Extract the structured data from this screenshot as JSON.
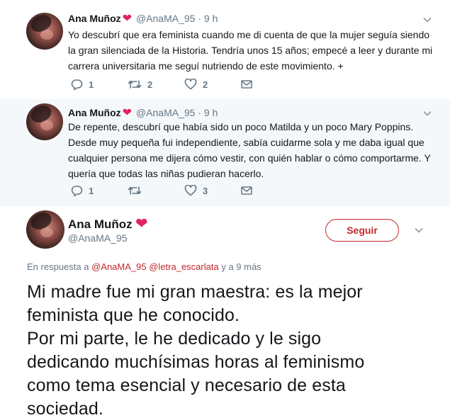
{
  "colors": {
    "heart": "#e0245e",
    "accent": "#c2272d",
    "muted": "#657786",
    "thread_line": "#d8a6b0"
  },
  "tweets": [
    {
      "name": "Ana Muñoz",
      "handle": "@AnaMA_95",
      "separator": "·",
      "time": "9 h",
      "text": "Yo descubrí que era feminista cuando me di cuenta de que la mujer seguía siendo la gran silenciada de la Historia. Tendría unos 15 años; empecé a leer y durante mi carrera universitaria me seguí nutriendo de este movimiento. +",
      "replies": "1",
      "retweets": "2",
      "likes": "2"
    },
    {
      "name": "Ana Muñoz",
      "handle": "@AnaMA_95",
      "separator": "·",
      "time": "9 h",
      "text": "De repente, descubrí que había sido un poco Matilda y un poco Mary Poppins. Desde muy pequeña fui independiente, sabía cuidarme sola y me daba igual que cualquier persona me dijera cómo vestir, con quién hablar o cómo comportarme. Y quería que todas las niñas pudieran hacerlo.",
      "replies": "1",
      "retweets": "",
      "likes": "3"
    }
  ],
  "main": {
    "name": "Ana Muñoz",
    "handle": "@AnaMA_95",
    "follow_label": "Seguir",
    "reply_prefix": "En respuesta a",
    "reply_user1": "@AnaMA_95",
    "reply_user2": "@letra_escarlata",
    "reply_suffix": "y a 9 más",
    "text_lines": [
      "Mi madre fue mi gran maestra: es la mejor",
      "feminista que he conocido.",
      "Por mi parte, le he dedicado y le sigo",
      "dedicando muchísimas horas al feminismo",
      "como tema esencial y necesario de esta",
      "sociedad."
    ]
  }
}
